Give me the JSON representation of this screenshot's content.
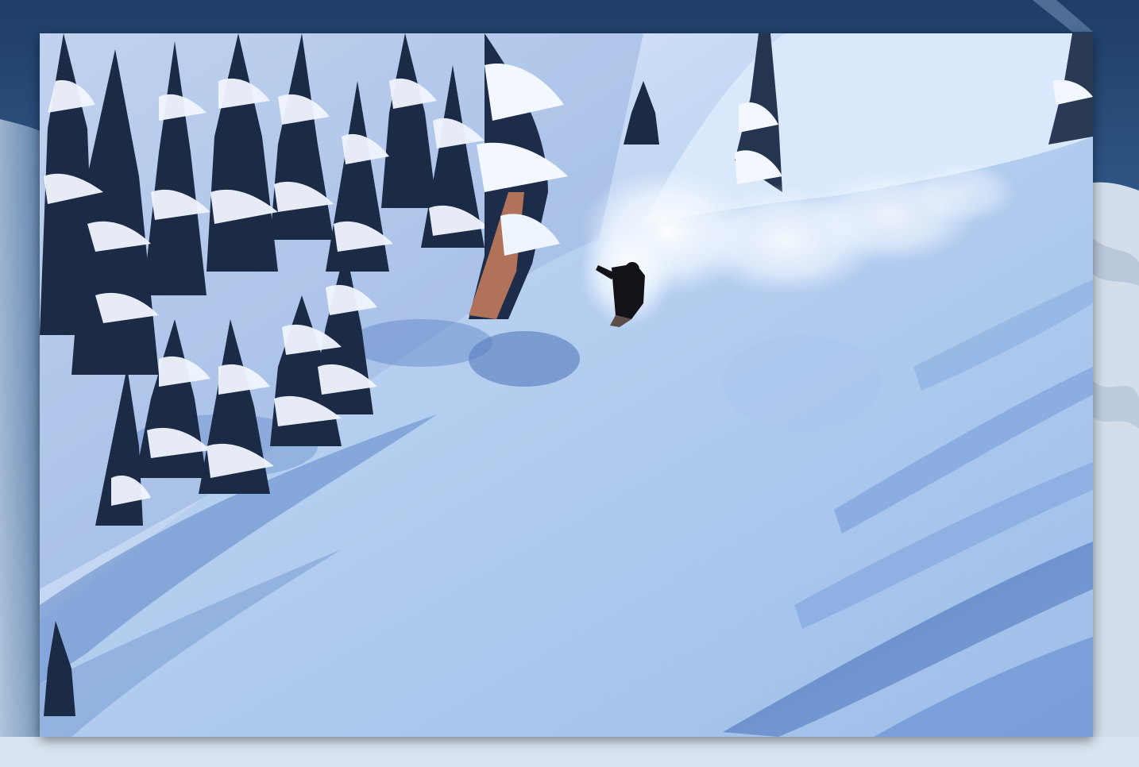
{
  "photo": {
    "subject": "snowboarder-carving-powder",
    "colors": {
      "backdrop_top": "#1f3d66",
      "backdrop_mid": "#3a6390",
      "backdrop_snow": "#c9d8ea",
      "snow_light": "#eef5ff",
      "snow_mid": "#c7dcf6",
      "snow_shadow": "#5f86c7",
      "snow_deep_shadow": "#3f66ad",
      "tree_dark": "#1b2a45",
      "trunk": "#b0735a",
      "rider": "#111318"
    }
  }
}
